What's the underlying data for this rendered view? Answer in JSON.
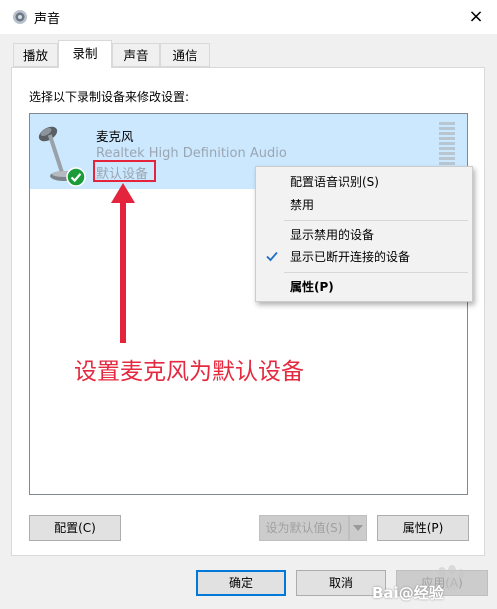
{
  "window": {
    "title": "声音",
    "close_glyph": "×"
  },
  "tabs": [
    {
      "label": "播放",
      "active": false
    },
    {
      "label": "录制",
      "active": true
    },
    {
      "label": "声音",
      "active": false
    },
    {
      "label": "通信",
      "active": false
    }
  ],
  "panel": {
    "instruction": "选择以下录制设备来修改设置:"
  },
  "device": {
    "name": "麦克风",
    "description": "Realtek High Definition Audio",
    "status": "默认设备",
    "icon": "microphone-icon",
    "badge_icon": "default-check-badge-icon"
  },
  "context_menu": {
    "items": [
      {
        "label": "配置语音识别(S)",
        "checked": false,
        "bold": false
      },
      {
        "label": "禁用",
        "checked": false,
        "bold": false
      },
      {
        "label": "显示禁用的设备",
        "checked": false,
        "bold": false
      },
      {
        "label": "显示已断开连接的设备",
        "checked": true,
        "bold": false
      },
      {
        "label": "属性(P)",
        "checked": false,
        "bold": true
      }
    ]
  },
  "annotation": {
    "text": "设置麦克风为默认设备",
    "color": "#e52a40"
  },
  "buttons": {
    "configure": "配置(C)",
    "set_default": "设为默认值(S)",
    "properties": "属性(P)",
    "ok": "确定",
    "cancel": "取消",
    "apply": "应用(A)"
  },
  "watermark": {
    "text": "Bai@经验"
  },
  "colors": {
    "selection": "#cce8ff",
    "accent": "#0078d7",
    "highlight": "#e4243c"
  }
}
